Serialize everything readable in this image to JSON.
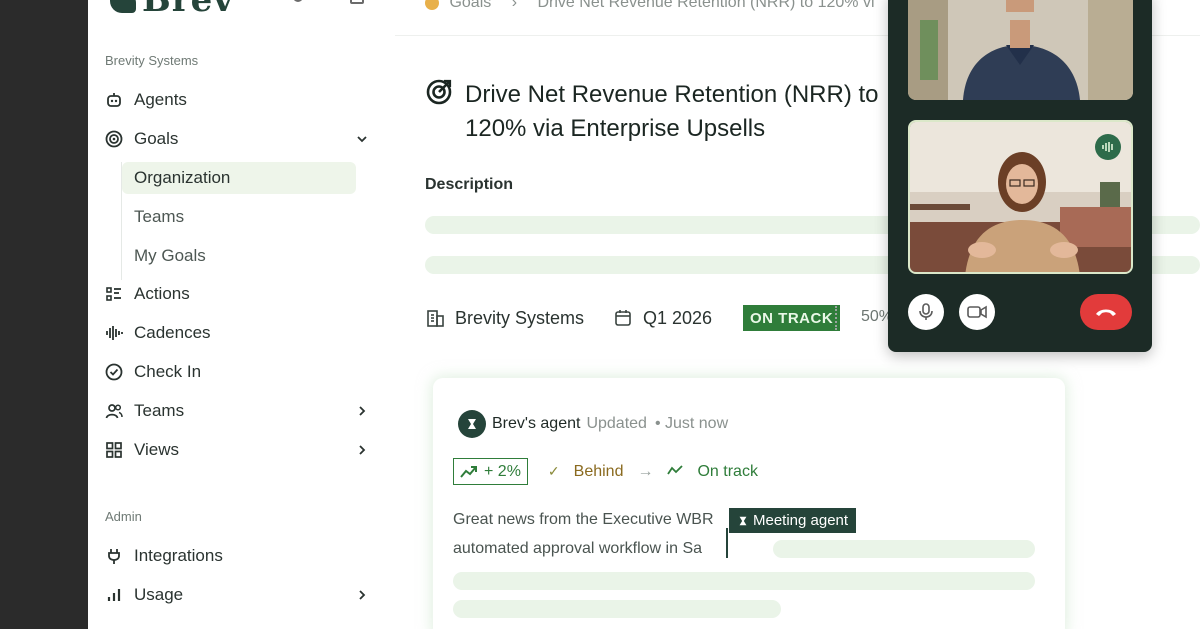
{
  "app": {
    "logo_text": "Brev"
  },
  "sidebar": {
    "workspace_label": "Brevity Systems",
    "items": [
      {
        "label": "Agents",
        "icon": "robot-icon"
      },
      {
        "label": "Goals",
        "icon": "target-icon",
        "expanded": true
      },
      {
        "label": "Actions",
        "icon": "list-check-icon"
      },
      {
        "label": "Cadences",
        "icon": "waveform-icon"
      },
      {
        "label": "Check In",
        "icon": "check-circle-icon"
      },
      {
        "label": "Teams",
        "icon": "users-icon",
        "has_submenu": true
      },
      {
        "label": "Views",
        "icon": "grid-icon",
        "has_submenu": true
      }
    ],
    "goals_subitems": [
      {
        "label": "Organization",
        "active": true
      },
      {
        "label": "Teams"
      },
      {
        "label": "My Goals"
      }
    ],
    "admin_label": "Admin",
    "admin_items": [
      {
        "label": "Integrations",
        "icon": "plug-icon"
      },
      {
        "label": "Usage",
        "icon": "bar-chart-icon",
        "has_submenu": true
      }
    ]
  },
  "breadcrumb": {
    "root": "Goals",
    "current": "Drive Net Revenue Retention (NRR) to 120% vi"
  },
  "goal": {
    "title": "Drive Net Revenue Retention (NRR) to 120% via Enterprise Upsells",
    "description_label": "Description",
    "organization": "Brevity Systems",
    "period": "Q1 2026",
    "status": "ON TRACK",
    "progress_text": "50%"
  },
  "update_card": {
    "author": "Brev's agent",
    "action": "Updated",
    "time": "• Just now",
    "delta": "+ 2%",
    "from_status": "Behind",
    "to_status": "On track",
    "message_line1": "Great news from the Executive WBR",
    "message_line2": "automated approval workflow in Sa",
    "tag": "Meeting agent"
  },
  "video_call": {
    "participants": 2,
    "controls": [
      "mic-icon",
      "camera-icon",
      "hang-up-icon"
    ]
  },
  "colors": {
    "brand_dark": "#25443a",
    "status_green": "#2f7d3a",
    "skeleton": "#eaf4e8",
    "hangup_red": "#e23b3b"
  }
}
